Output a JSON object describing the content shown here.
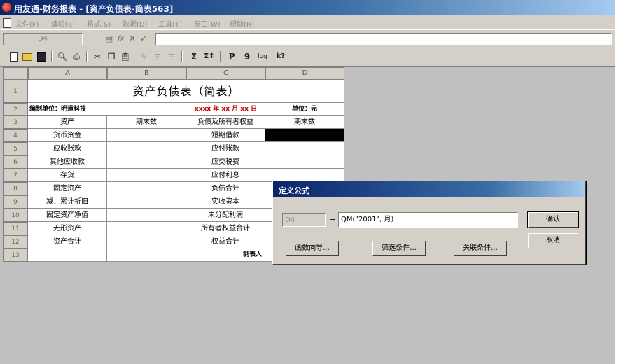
{
  "window": {
    "title": "用友通-财务报表 - [资产负债表-简表563]"
  },
  "menu": {
    "items": [
      "文件(F)",
      "编辑(E)",
      "格式(S)",
      "数据(D)",
      "工具(T)",
      "窗口(W)",
      "帮助(H)"
    ]
  },
  "formula_bar": {
    "cell_ref": "D4",
    "fx_label": "fx"
  },
  "toolbar": {
    "sigma_label": "Σ",
    "sigma_sort_label": "Σ↕",
    "p_label": "P",
    "nine_label": "9",
    "log_label": "log",
    "help_label": "k?"
  },
  "sheet": {
    "columns": [
      "A",
      "B",
      "C",
      "D"
    ],
    "rows": [
      "1",
      "2",
      "3",
      "4",
      "5",
      "6",
      "7",
      "8",
      "9",
      "10",
      "11",
      "12",
      "13"
    ],
    "title": "资产负债表（简表）",
    "unit_row": {
      "company": "编制单位：明道科技",
      "date": "xxxx 年 xx 月 xx 日",
      "unit": "单位：元"
    },
    "headers": [
      "资产",
      "期末数",
      "负债及所有者权益",
      "期末数"
    ],
    "assets": [
      "货币资金",
      "应收账款",
      "其他应收款",
      "存货",
      "固定资产",
      "减：累计折旧",
      "固定资产净值",
      "无形资产",
      "资产合计"
    ],
    "liabilities": [
      "短期借款",
      "应付账款",
      "应交税费",
      "应付利息",
      "负债合计",
      "实收资本",
      "未分配利润",
      "所有者权益合计",
      "权益合计"
    ],
    "footer": "制表人"
  },
  "dialog": {
    "title": "定义公式",
    "ref": "D4",
    "equals": "=",
    "formula": "QM(\"2001\", 月)",
    "ok_label": "确认",
    "cancel_label": "取消",
    "func_wizard_label": "函数向导...",
    "filter_label": "筛选条件...",
    "relation_label": "关联条件..."
  }
}
